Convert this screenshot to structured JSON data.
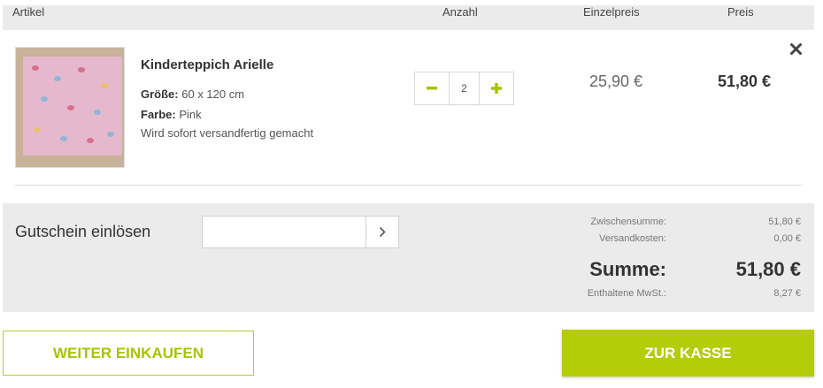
{
  "table_header": {
    "article": "Artikel",
    "quantity": "Anzahl",
    "unit_price": "Einzelpreis",
    "price": "Preis"
  },
  "item": {
    "title": "Kinderteppich Arielle",
    "size_label": "Größe:",
    "size_value": "60 x 120 cm",
    "color_label": "Farbe:",
    "color_value": "Pink",
    "shipping_note": "Wird sofort versandfertig gemacht",
    "quantity": "2",
    "decrement_icon": "minus-icon",
    "increment_icon": "plus-icon",
    "unit_price": "25,90 €",
    "line_price": "51,80 €",
    "remove_icon": "close-icon"
  },
  "coupon": {
    "label": "Gutschein einlösen",
    "input_value": "",
    "submit_icon": "chevron-right-icon"
  },
  "summary": {
    "subtotal_label": "Zwischensumme:",
    "subtotal_value": "51,80 €",
    "shipping_label": "Versandkosten:",
    "shipping_value": "0,00 €",
    "total_label": "Summe:",
    "total_value": "51,80 €",
    "vat_label": "Enthaltene MwSt.:",
    "vat_value": "8,27 €"
  },
  "actions": {
    "continue_label": "WEITER EINKAUFEN",
    "checkout_label": "ZUR KASSE"
  },
  "colors": {
    "accent": "#b5cc08",
    "header_bg": "#ebebeb"
  }
}
